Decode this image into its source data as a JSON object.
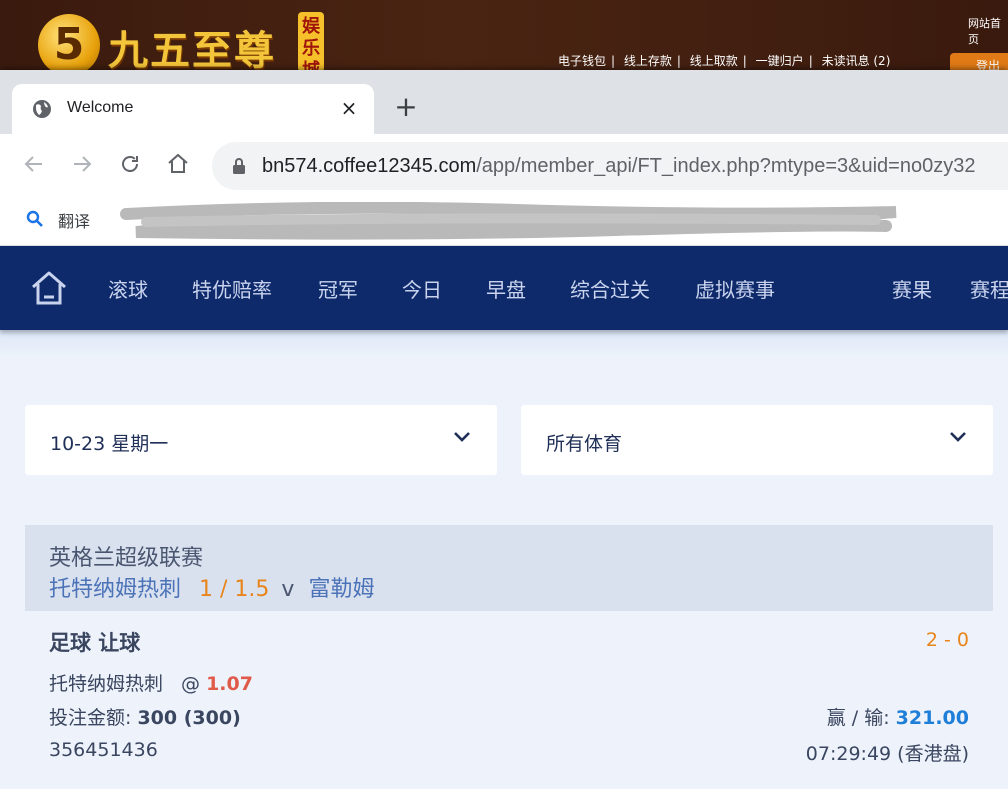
{
  "site": {
    "logo_digit": "5",
    "logo_text": "九五至尊",
    "logo_badge": "娱乐城",
    "home_link": "网站首页",
    "links": [
      "电子钱包",
      "线上存款",
      "线上取款",
      "一键归户",
      "未读讯息 (2)"
    ],
    "logout": "登出"
  },
  "browser": {
    "tab_title": "Welcome",
    "close_glyph": "×",
    "new_tab_glyph": "+",
    "url_host": "bn574.coffee12345.com",
    "url_path": "/app/member_api/FT_index.php?mtype=3&uid=no0zy32",
    "bookmark_translate": "翻译"
  },
  "app": {
    "nav": [
      "滚球",
      "特优赔率",
      "冠军",
      "今日",
      "早盘",
      "综合过关",
      "虚拟赛事",
      "赛果",
      "赛程"
    ],
    "filters": {
      "date": "10-23 星期一",
      "sport": "所有体育"
    },
    "league": {
      "name": "英格兰超级联赛",
      "home": "托特纳姆热刺",
      "handicap": "1 / 1.5",
      "vs": "v",
      "away": "富勒姆"
    },
    "bet": {
      "type": "足球 让球",
      "score": "2 - 0",
      "pick": "托特纳姆热刺",
      "at": "@",
      "odds": "1.07",
      "stake_label": "投注金额:",
      "stake_value": "300 (300)",
      "winloss_label": "赢 / 输:",
      "winloss_value": "321.00",
      "ticket_id": "356451436",
      "time": "07:29:49 (香港盘)"
    }
  }
}
